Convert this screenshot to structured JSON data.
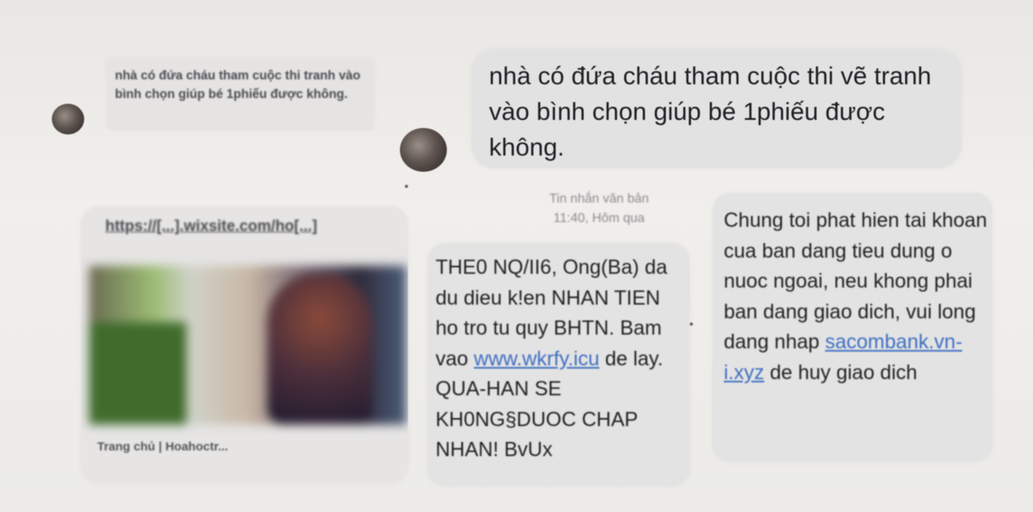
{
  "conversation": {
    "small_message": {
      "text": "nhà có đứa cháu tham cuộc thi tranh vào bình chọn giúp bé 1phiếu được không."
    },
    "big_message": {
      "text": "nhà có đứa cháu tham cuộc thi vẽ tranh vào bình chọn giúp bé 1phiếu được không."
    },
    "meta": {
      "line1": "Tin nhắn văn bản",
      "line2": "11:40, Hôm qua"
    },
    "link_card": {
      "url": "https://[...].wixsite.com/ho[...]",
      "footer": "Trang chủ | Hoahoctr..."
    },
    "sms_left": {
      "before_link": "THE0 NQ/II6, Ong(Ba) da du dieu k!en NHAN TIEN ho tro tu quy BHTN. Bam vao ",
      "link": "www.wkrfy.icu",
      "after_link": " de lay. QUA-HAN SE KH0NG§DUOC CHAP NHAN! BvUx"
    },
    "sms_right": {
      "before_link": "Chung toi phat hien tai khoan cua ban dang tieu dung o nuoc ngoai, neu khong phai ban dang giao dich, vui long dang nhap ",
      "link": "sacombank.vn-i.xyz",
      "after_link": " de huy giao dich"
    }
  },
  "colors": {
    "bubble": "#e3e2e3",
    "link": "#3f6fc2",
    "meta_text": "#8b8a8e"
  },
  "icons": {
    "avatar": "contact-avatar"
  }
}
